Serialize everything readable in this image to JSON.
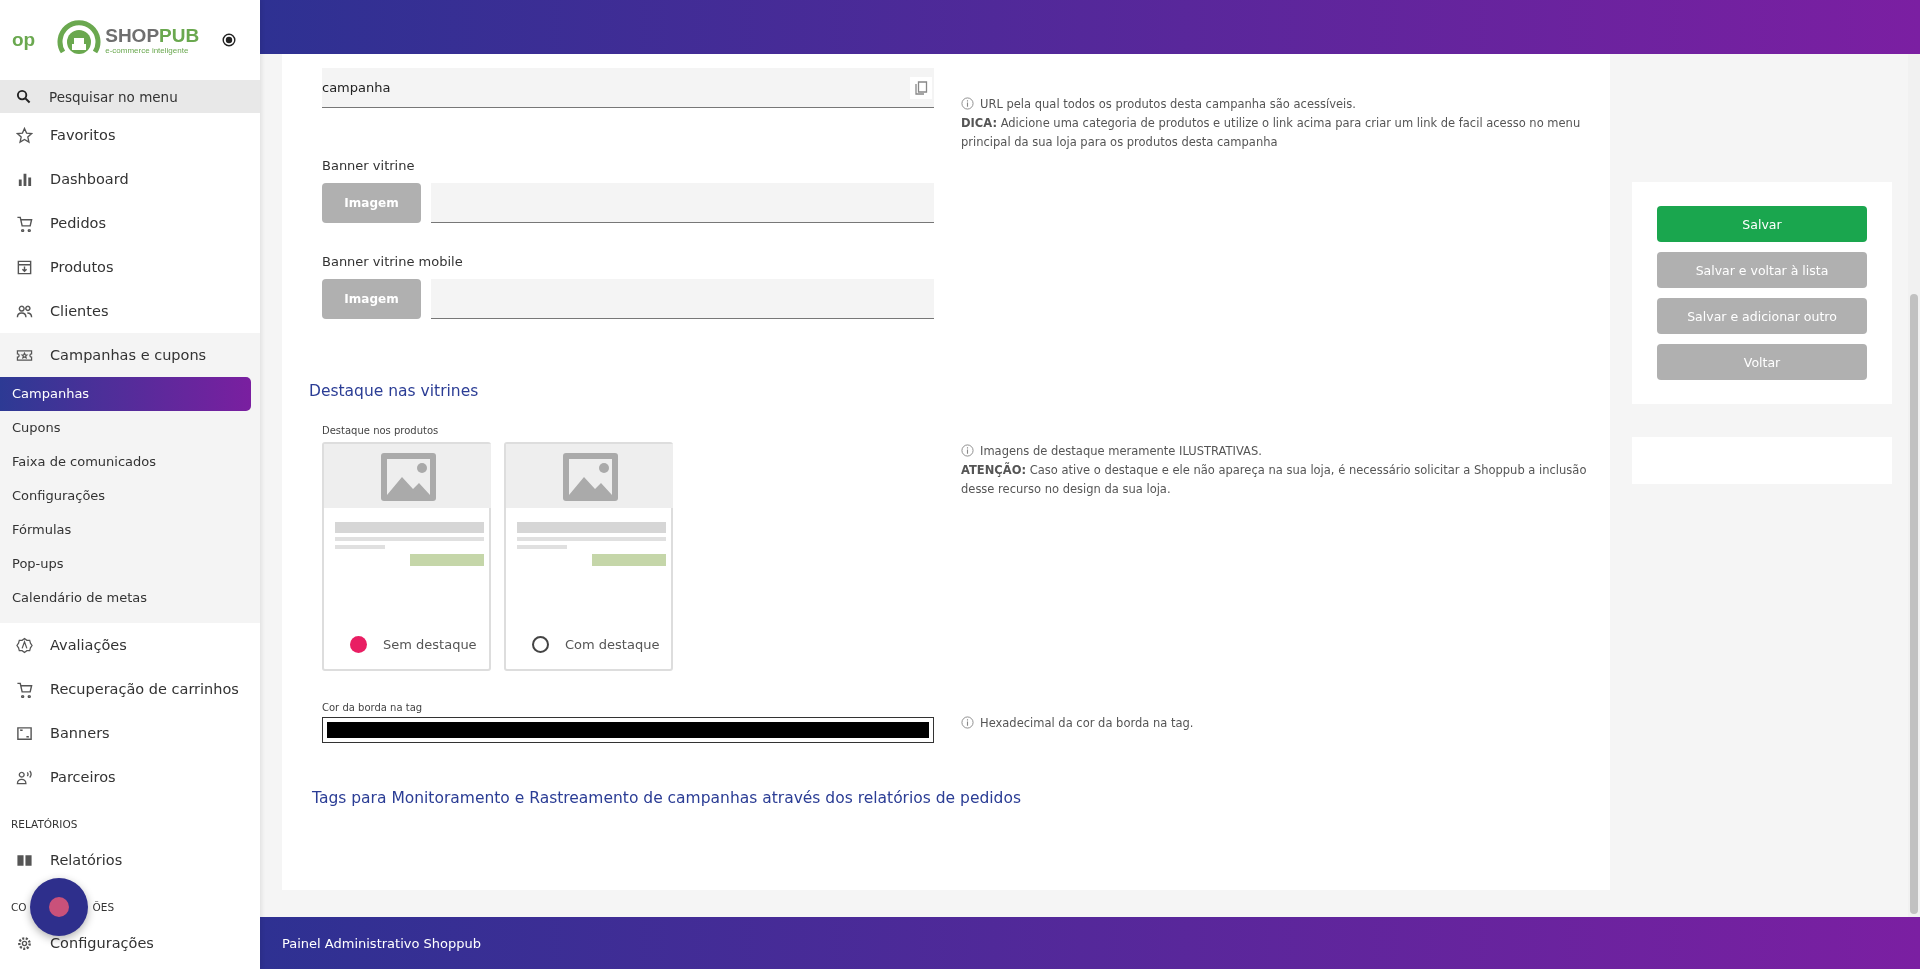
{
  "sidebar": {
    "logo": {
      "mark": "op",
      "name_parts": [
        "SHOP",
        "PUB"
      ],
      "tagline": "e-commerce inteligente"
    },
    "search": {
      "placeholder": "Pesquisar no menu"
    },
    "menu": [
      {
        "kind": "link",
        "label": "Favoritos"
      },
      {
        "kind": "link",
        "label": "Dashboard"
      },
      {
        "kind": "link",
        "label": "Pedidos"
      },
      {
        "kind": "link",
        "label": "Produtos"
      },
      {
        "kind": "link",
        "label": "Clientes"
      },
      {
        "kind": "group",
        "label": "Campanhas e cupons",
        "expanded": true,
        "children": [
          {
            "label": "Campanhas",
            "selected": true
          },
          {
            "label": "Cupons",
            "selected": false
          },
          {
            "label": "Faixa de comunicados",
            "selected": false
          },
          {
            "label": "Configurações",
            "selected": false
          },
          {
            "label": "Fórmulas",
            "selected": false
          },
          {
            "label": "Pop-ups",
            "selected": false
          },
          {
            "label": "Calendário de metas",
            "selected": false
          }
        ]
      },
      {
        "kind": "link",
        "label": "Avaliações"
      },
      {
        "kind": "link",
        "label": "Recuperação de carrinhos"
      },
      {
        "kind": "link",
        "label": "Banners"
      },
      {
        "kind": "link",
        "label": "Parceiros"
      },
      {
        "kind": "section",
        "label_parts": [
          "RELATÓRIOS"
        ]
      },
      {
        "kind": "link",
        "label": "Relatórios"
      },
      {
        "kind": "section",
        "label_parts": [
          "CO",
          "ÕES"
        ]
      },
      {
        "kind": "link",
        "label": "Configurações"
      }
    ]
  },
  "form": {
    "url_field": {
      "value": "campanha"
    },
    "url_help": {
      "text": "URL pela qual todos os produtos desta campanha são acessíveis.",
      "tip": "**DICA:** Adicione uma categoria de produtos e utilize o link acima para criar um link de facil acesso no menu principal da sua loja para os produtos desta campanha"
    },
    "banners": [
      {
        "label": "Banner vitrine",
        "button": "Imagem"
      },
      {
        "label": "Banner vitrine mobile",
        "button": "Imagem"
      }
    ],
    "highlight": {
      "title": "Destaque nas vitrines",
      "field_label": "Destaque nos produtos",
      "options": [
        {
          "label": "Sem destaque",
          "selected": true
        },
        {
          "label": "Com destaque",
          "selected": false
        }
      ],
      "help": {
        "text": "Imagens de destaque meramente ILUSTRATIVAS.",
        "note": "**ATENÇÃO:** Caso ative o destaque e ele não apareça na sua loja, é necessário solicitar a Shoppub a inclusão desse recurso no design da sua loja."
      }
    },
    "border_color": {
      "label": "Cor da borda na tag",
      "help": "Hexadecimal da cor da borda na tag."
    },
    "tags_title": "Tags para Monitoramento e Rastreamento de campanhas através dos relatórios de pedidos"
  },
  "actions": [
    {
      "label": "Salvar",
      "kind": "primary"
    },
    {
      "label": "Salvar e voltar à lista",
      "kind": "secondary"
    },
    {
      "label": "Salvar e adicionar outro",
      "kind": "secondary"
    },
    {
      "label": "Voltar",
      "kind": "secondary"
    }
  ],
  "footer": {
    "text": "Painel Administrativo Shoppub"
  }
}
